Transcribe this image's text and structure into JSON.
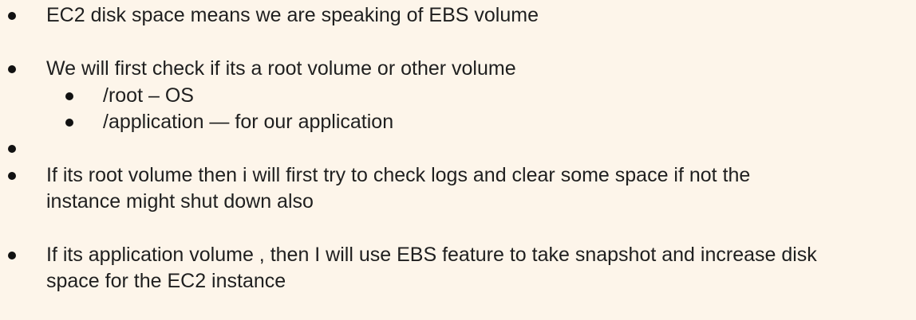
{
  "slide": {
    "bullets": [
      {
        "lines": [
          "EC2 disk space means we are speaking of EBS volume"
        ]
      },
      {
        "lines": [
          "We will first check if its a root volume or other volume"
        ],
        "sub": [
          "/root – OS",
          "/application — for our application"
        ]
      },
      {
        "lines": []
      },
      {
        "lines": [
          "If its root volume then i will first try to check logs and clear some space if not the",
          "instance might shut down also"
        ]
      },
      {
        "lines": [
          "If its application volume , then I will use EBS feature to take snapshot and increase disk",
          "space for the EC2 instance"
        ]
      }
    ]
  }
}
